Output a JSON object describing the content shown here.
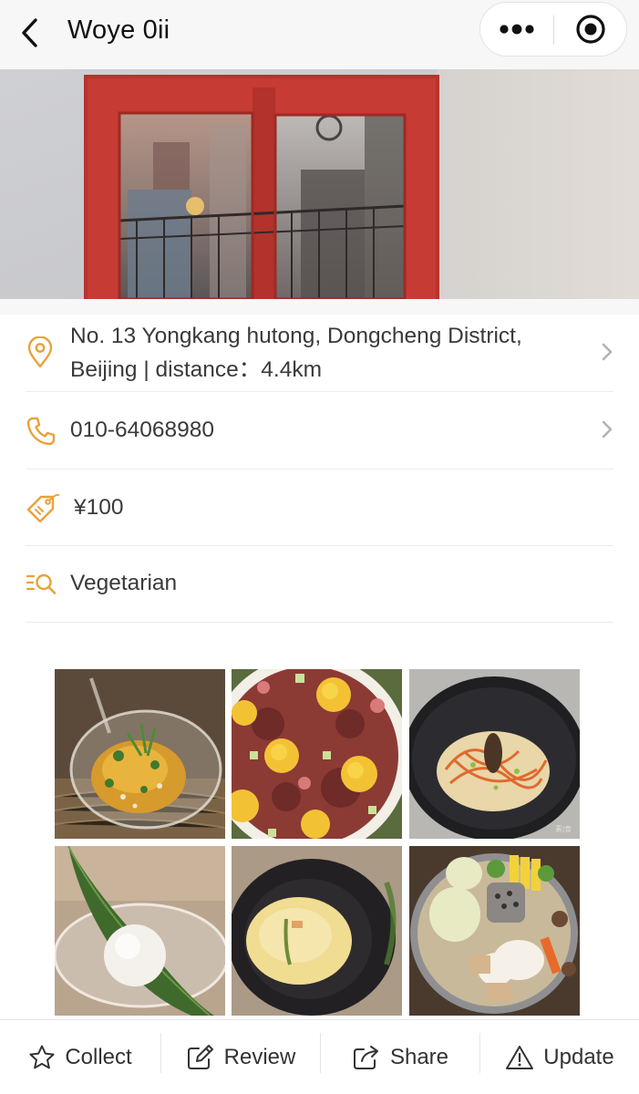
{
  "header": {
    "title": "Woye 0ii",
    "back_icon": "chevron-left-icon",
    "more_icon": "more-dots-icon",
    "target_icon": "target-circle-icon"
  },
  "info": {
    "address": "No. 13 Yongkang hutong, Dongcheng District, Beijing | distance：4.4km",
    "phone": "010-64068980",
    "price": "¥100",
    "cuisine": "Vegetarian"
  },
  "gallery": {
    "photos": [
      "glass-bowl-salad",
      "flower-salad",
      "pasta-dark-plate",
      "rice-ball-leaf",
      "soup-black-bowl",
      "hotpot"
    ]
  },
  "bottom_bar": {
    "collect": "Collect",
    "review": "Review",
    "share": "Share",
    "update": "Update"
  },
  "colors": {
    "accent": "#e9a23b",
    "divider": "#ececec",
    "background": "#f7f7f8"
  }
}
